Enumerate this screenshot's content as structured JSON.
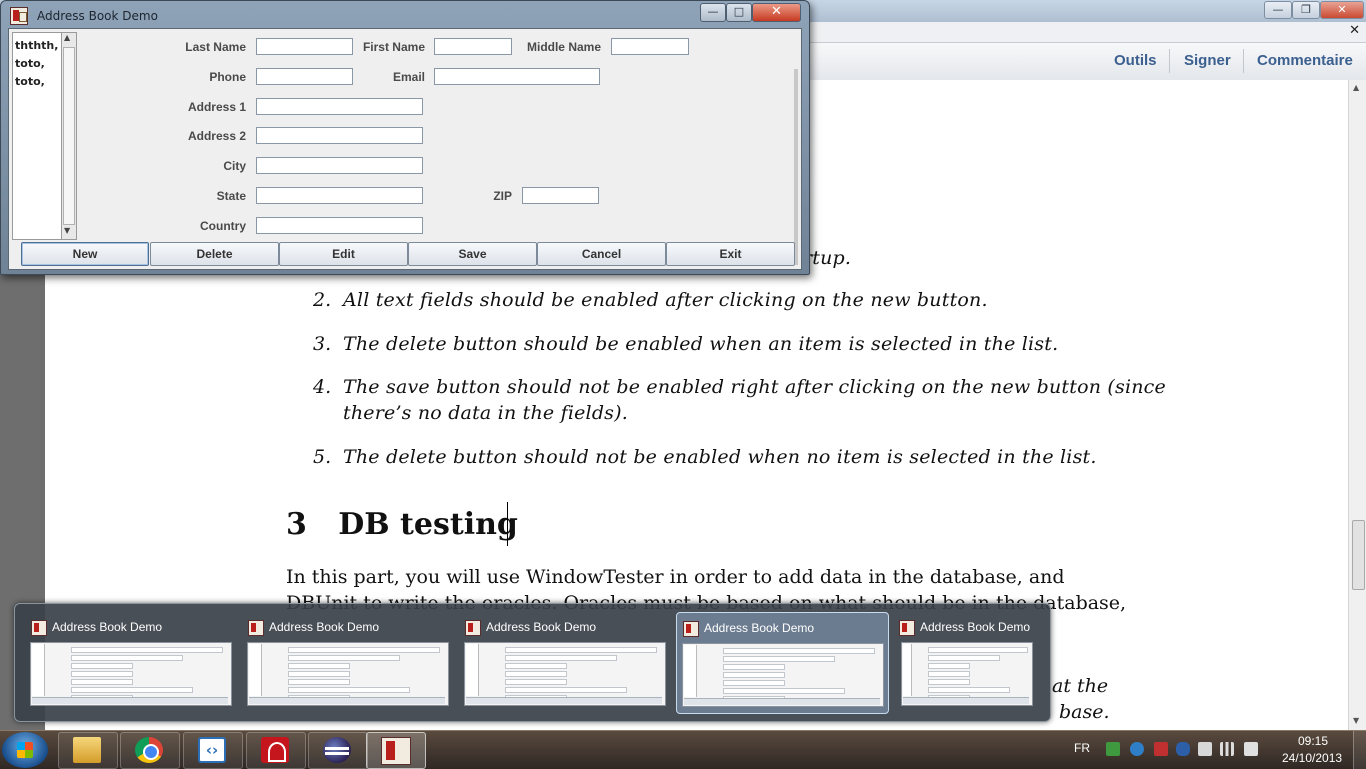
{
  "reader": {
    "toolbar": {
      "tools": "Outils",
      "sign": "Signer",
      "comment": "Commentaire"
    },
    "doc": {
      "items": [
        {
          "num": "",
          "text": "rtup."
        },
        {
          "num": "2.",
          "text": "All text fields should be enabled after clicking on the new button."
        },
        {
          "num": "3.",
          "text": "The delete button should be enabled when an item is selected in the list."
        },
        {
          "num": "4.",
          "text": "The save button should not be enabled right after clicking on the new button (since"
        },
        {
          "num": "",
          "text": "there’s no data in the fields)."
        },
        {
          "num": "5.",
          "text": "The delete button should not be enabled when no item is selected in the list."
        }
      ],
      "section_number": "3",
      "section_title": "DB testing",
      "para_line1": "In this part, you will use WindowTester in order to add data in the database, and",
      "para_line2": "DBUnit to write the oracles. Oracles must be based on what should be in the database,",
      "para_line3_end": "at the",
      "para_line4_end": "base."
    }
  },
  "addressbook": {
    "title": "Address Book Demo",
    "list_items": [
      "ththth,",
      "toto,",
      "toto,"
    ],
    "labels": {
      "last_name": "Last Name",
      "first_name": "First Name",
      "middle_name": "Middle Name",
      "phone": "Phone",
      "email": "Email",
      "address1": "Address 1",
      "address2": "Address 2",
      "city": "City",
      "state": "State",
      "zip": "ZIP",
      "country": "Country"
    },
    "fields": {
      "last_name": "",
      "first_name": "",
      "middle_name": "",
      "phone": "",
      "email": "",
      "address1": "",
      "address2": "",
      "city": "",
      "state": "",
      "zip": "",
      "country": ""
    },
    "buttons": {
      "new": "New",
      "delete": "Delete",
      "edit": "Edit",
      "save": "Save",
      "cancel": "Cancel",
      "exit": "Exit"
    }
  },
  "thumbnails": {
    "titles": [
      "Address Book Demo",
      "Address Book Demo",
      "Address Book Demo",
      "Address Book Demo",
      "Address Book Demo"
    ],
    "active_index": 3
  },
  "taskbar": {
    "apps": [
      "explorer-icon",
      "chrome-icon",
      "eclipse-dev-icon",
      "acrobat-icon",
      "eclipse-icon",
      "address-book-icon"
    ],
    "active_app": "address-book-icon",
    "tray": {
      "language": "FR",
      "time": "09:15",
      "date": "24/10/2013"
    }
  },
  "colors": {
    "link_blue": "#3b5f8f",
    "taskbar": "#3a3029",
    "active_thumb": "#96b4d7"
  }
}
